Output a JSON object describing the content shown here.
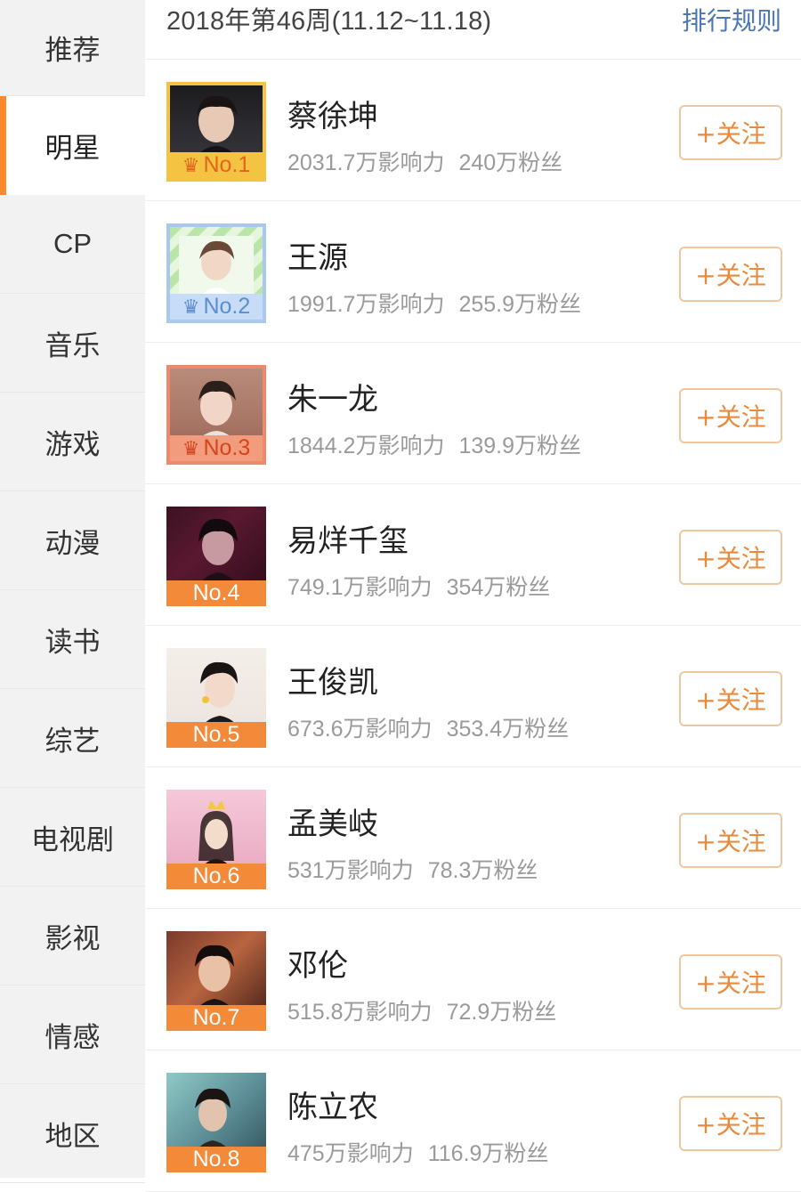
{
  "sidebar": {
    "items": [
      {
        "label": "推荐",
        "active": false
      },
      {
        "label": "明星",
        "active": true
      },
      {
        "label": "CP",
        "active": false
      },
      {
        "label": "音乐",
        "active": false
      },
      {
        "label": "游戏",
        "active": false
      },
      {
        "label": "动漫",
        "active": false
      },
      {
        "label": "读书",
        "active": false
      },
      {
        "label": "综艺",
        "active": false
      },
      {
        "label": "电视剧",
        "active": false
      },
      {
        "label": "影视",
        "active": false
      },
      {
        "label": "情感",
        "active": false
      },
      {
        "label": "地区",
        "active": false
      }
    ]
  },
  "header": {
    "week_title": "2018年第46周(11.12~11.18)",
    "rules_label": "排行规则"
  },
  "ranking": [
    {
      "rank": "No.1",
      "name": "蔡徐坤",
      "influence": "2031.7万影响力",
      "fans": "240万粉丝",
      "follow_label": "+关注"
    },
    {
      "rank": "No.2",
      "name": "王源",
      "influence": "1991.7万影响力",
      "fans": "255.9万粉丝",
      "follow_label": "+关注"
    },
    {
      "rank": "No.3",
      "name": "朱一龙",
      "influence": "1844.2万影响力",
      "fans": "139.9万粉丝",
      "follow_label": "+关注"
    },
    {
      "rank": "No.4",
      "name": "易烊千玺",
      "influence": "749.1万影响力",
      "fans": "354万粉丝",
      "follow_label": "+关注"
    },
    {
      "rank": "No.5",
      "name": "王俊凯",
      "influence": "673.6万影响力",
      "fans": "353.4万粉丝",
      "follow_label": "+关注"
    },
    {
      "rank": "No.6",
      "name": "孟美岐",
      "influence": "531万影响力",
      "fans": "78.3万粉丝",
      "follow_label": "+关注"
    },
    {
      "rank": "No.7",
      "name": "邓伦",
      "influence": "515.8万影响力",
      "fans": "72.9万粉丝",
      "follow_label": "+关注"
    },
    {
      "rank": "No.8",
      "name": "陈立农",
      "influence": "475万影响力",
      "fans": "116.9万粉丝",
      "follow_label": "+关注"
    }
  ],
  "colors": {
    "accent": "#ff8a2b",
    "link": "#4a77b5",
    "follow_text": "#e98a3c",
    "gold": "#f5c342",
    "silver": "#c7dcf6",
    "bronze": "#f29c7e"
  }
}
